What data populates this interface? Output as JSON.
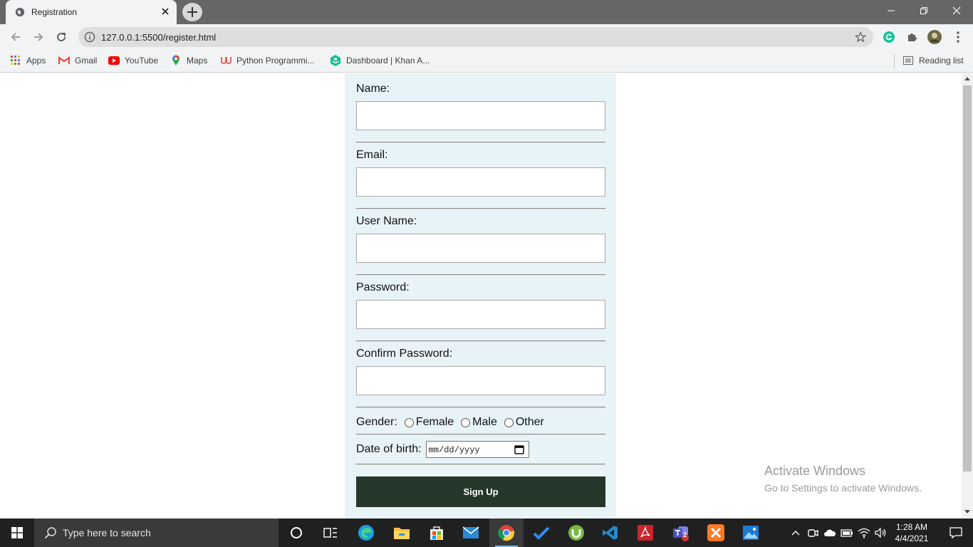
{
  "browser": {
    "tab": {
      "title": "Registration"
    },
    "address": {
      "url": "127.0.0.1:5500/register.html"
    },
    "bookmarks": [
      {
        "label": "Apps",
        "icon": "apps-grid-icon"
      },
      {
        "label": "Gmail",
        "icon": "gmail-icon"
      },
      {
        "label": "YouTube",
        "icon": "youtube-icon"
      },
      {
        "label": "Maps",
        "icon": "maps-icon"
      },
      {
        "label": "Python Programmi...",
        "icon": "udemy-icon"
      },
      {
        "label": "Dashboard | Khan A...",
        "icon": "khan-academy-icon"
      }
    ],
    "reading_list": "Reading list"
  },
  "form": {
    "name_label": "Name:",
    "email_label": "Email:",
    "username_label": "User Name:",
    "password_label": "Password:",
    "confirm_label": "Confirm Password:",
    "gender_label": "Gender:",
    "gender_options": [
      "Female",
      "Male",
      "Other"
    ],
    "dob_label": "Date of birth:",
    "dob_placeholder": "mm/dd/yyyy",
    "submit_label": "Sign Up"
  },
  "watermark": {
    "title": "Activate Windows",
    "subtitle": "Go to Settings to activate Windows."
  },
  "taskbar": {
    "search_placeholder": "Type here to search",
    "teams_badge": "2",
    "time": "1:28 AM",
    "date": "4/4/2021"
  },
  "colors": {
    "form_background": "#e8f3f7",
    "button_background": "#25372a",
    "tab_strip": "#666666"
  }
}
